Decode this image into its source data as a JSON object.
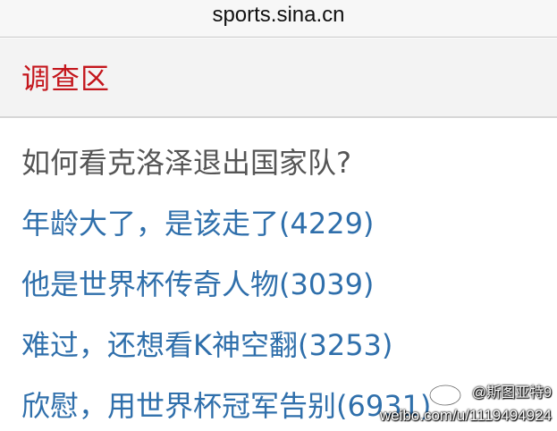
{
  "browser": {
    "url": "sports.sina.cn"
  },
  "survey": {
    "section_title": "调查区",
    "question": "如何看克洛泽退出国家队?",
    "options": [
      {
        "label": "年龄大了，是该走了(4229)"
      },
      {
        "label": "他是世界杯传奇人物(3039)"
      },
      {
        "label": "难过，还想看K神空翻(3253)"
      },
      {
        "label": "欣慰，用世界杯冠军告别(6931)"
      }
    ]
  },
  "watermark": {
    "handle": "@斯图亚特9",
    "url": "weibo.com/u/1119494924"
  },
  "colors": {
    "accent_red": "#c4161c",
    "link_blue": "#2f6fab",
    "question_gray": "#555555"
  }
}
